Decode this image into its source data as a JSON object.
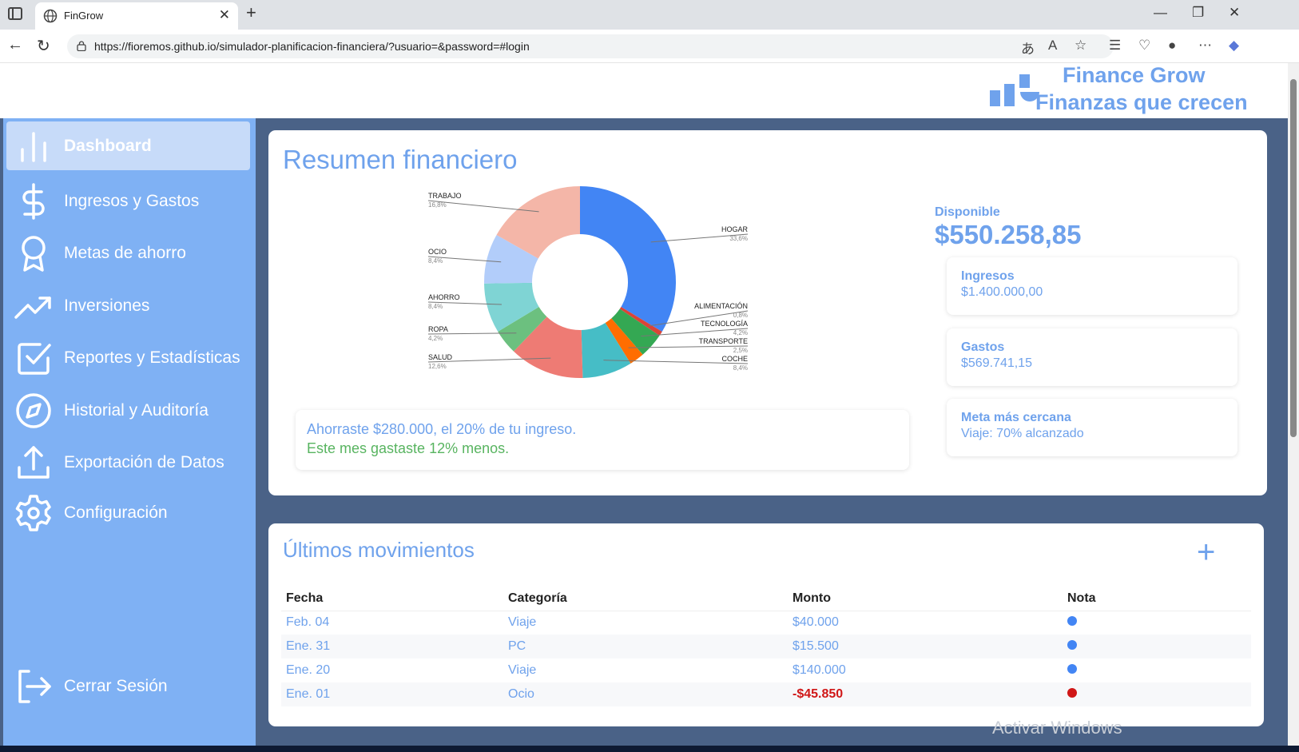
{
  "browser": {
    "tab_title": "FinGrow",
    "url": "https://fioremos.github.io/simulador-planificacion-financiera/?usuario=&password=#login"
  },
  "brand": {
    "title": "Finance Grow",
    "subtitle": "Finanzas que crecen"
  },
  "sidebar": {
    "items": [
      {
        "label": "Dashboard",
        "icon": "bar-chart-icon"
      },
      {
        "label": "Ingresos y Gastos",
        "icon": "dollar-icon"
      },
      {
        "label": "Metas de ahorro",
        "icon": "award-icon"
      },
      {
        "label": "Inversiones",
        "icon": "trending-up-icon"
      },
      {
        "label": "Reportes y Estadísticas",
        "icon": "check-square-icon"
      },
      {
        "label": "Historial y Auditoría",
        "icon": "compass-icon"
      },
      {
        "label": "Exportación de Datos",
        "icon": "upload-icon"
      },
      {
        "label": "Configuración",
        "icon": "gear-icon"
      }
    ],
    "logout": "Cerrar Sesión"
  },
  "summary": {
    "title": "Resumen financiero",
    "message1": "Ahorraste $280.000, el 20% de tu ingreso.",
    "message2": "Este mes gastaste 12% menos.",
    "available_label": "Disponible",
    "available_value": "$550.258,85",
    "income_label": "Ingresos",
    "income_value": "$1.400.000,00",
    "expense_label": "Gastos",
    "expense_value": "$569.741,15",
    "goal_label": "Meta más cercana",
    "goal_value": "Viaje: 70% alcanzado"
  },
  "chart_data": {
    "type": "pie",
    "slices": [
      {
        "label": "HOGAR",
        "pct_label": "33,6%",
        "value": 33.6,
        "color": "#4285f4"
      },
      {
        "label": "ALIMENTACIÓN",
        "pct_label": "0,8%",
        "value": 0.8,
        "color": "#db4437"
      },
      {
        "label": "TECNOLOGÍA",
        "pct_label": "4,2%",
        "value": 4.2,
        "color": "#34a853"
      },
      {
        "label": "TRANSPORTE",
        "pct_label": "2,5%",
        "value": 2.5,
        "color": "#ff6d00"
      },
      {
        "label": "COCHE",
        "pct_label": "8,4%",
        "value": 8.4,
        "color": "#46bdc6"
      },
      {
        "label": "SALUD",
        "pct_label": "12,6%",
        "value": 12.6,
        "color": "#ee7b74"
      },
      {
        "label": "ROPA",
        "pct_label": "4,2%",
        "value": 4.2,
        "color": "#6cc07f"
      },
      {
        "label": "AHORRO",
        "pct_label": "8,4%",
        "value": 8.4,
        "color": "#7fd4d4"
      },
      {
        "label": "OCIO",
        "pct_label": "8,4%",
        "value": 8.4,
        "color": "#b2cdfa"
      },
      {
        "label": "TRABAJO",
        "pct_label": "16,8%",
        "value": 16.8,
        "color": "#f4b6a8"
      }
    ]
  },
  "movements": {
    "title": "Últimos movimientos",
    "headers": [
      "Fecha",
      "Categoría",
      "Monto",
      "Nota"
    ],
    "rows": [
      {
        "date": "Feb. 04",
        "category": "Viaje",
        "amount": "$40.000",
        "dot": "#4285f4",
        "negative": false
      },
      {
        "date": "Ene. 31",
        "category": "PC",
        "amount": "$15.500",
        "dot": "#4285f4",
        "negative": false
      },
      {
        "date": "Ene. 20",
        "category": "Viaje",
        "amount": "$140.000",
        "dot": "#4285f4",
        "negative": false
      },
      {
        "date": "Ene. 01",
        "category": "Ocio",
        "amount": "-$45.850",
        "dot": "#d01717",
        "negative": true
      }
    ]
  },
  "watermark": "Activar Windows"
}
